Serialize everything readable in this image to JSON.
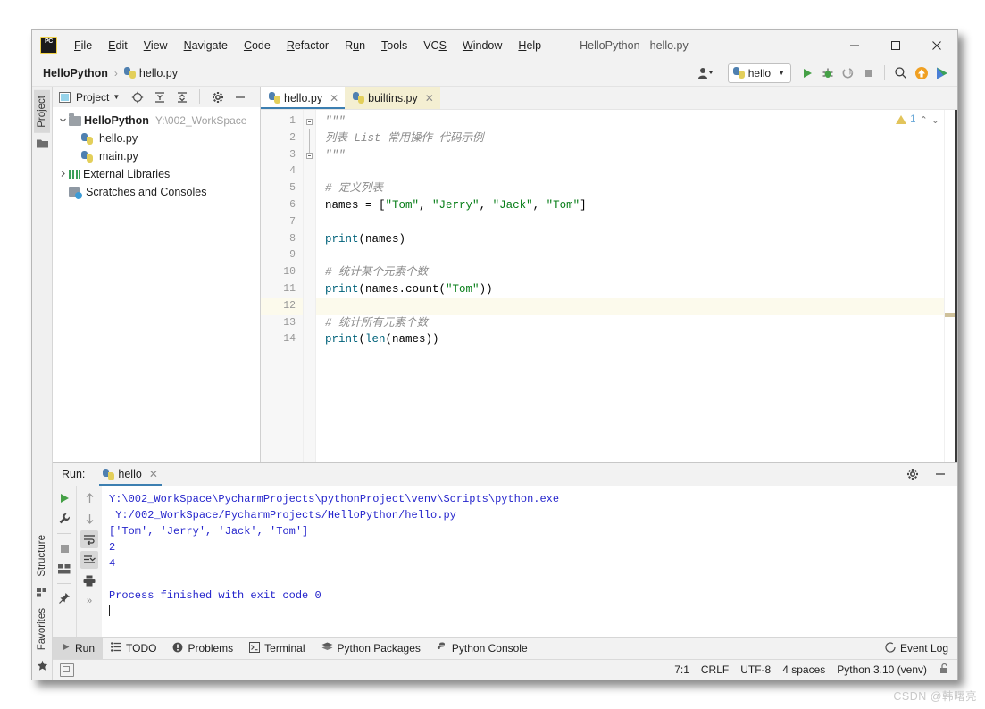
{
  "window": {
    "title": "HelloPython - hello.py",
    "logo_text": "PC",
    "minimize_label": "Minimize",
    "maximize_label": "Maximize",
    "close_label": "Close"
  },
  "menu": {
    "items": [
      {
        "mnemonic": "F",
        "rest": "ile"
      },
      {
        "mnemonic": "E",
        "rest": "dit"
      },
      {
        "mnemonic": "V",
        "rest": "iew"
      },
      {
        "mnemonic": "N",
        "rest": "avigate"
      },
      {
        "mnemonic": "C",
        "rest": "ode"
      },
      {
        "mnemonic": "R",
        "rest": "efactor"
      },
      {
        "mnemonic": "R",
        "rest": "un",
        "pre": "",
        "mid": "u"
      },
      {
        "mnemonic": "T",
        "rest": "ools"
      },
      {
        "mnemonic": "VC",
        "rest": "S"
      },
      {
        "mnemonic": "W",
        "rest": "indow"
      },
      {
        "mnemonic": "H",
        "rest": "elp"
      }
    ]
  },
  "navbar": {
    "breadcrumb_project": "HelloPython",
    "breadcrumb_sep": "›",
    "breadcrumb_file": "hello.py",
    "run_config": "hello",
    "icons": {
      "user": "user-avatar-icon",
      "run": "run-icon",
      "debug": "debug-icon",
      "coverage": "run-coverage-icon",
      "stop": "stop-icon",
      "search": "search-everywhere-icon",
      "update": "update-project-icon",
      "ide_help": "ide-features-trainer-icon"
    }
  },
  "left_strip": {
    "top": [
      {
        "label": "Project",
        "active": true
      }
    ],
    "bottom": [
      {
        "label": "Structure",
        "active": false
      },
      {
        "label": "Favorites",
        "active": false
      }
    ]
  },
  "project_panel": {
    "title": "Project",
    "toolbar_icons": [
      "locate-icon",
      "expand-all-icon",
      "collapse-all-icon",
      "settings-gear-icon",
      "hide-icon"
    ],
    "tree": [
      {
        "depth": 0,
        "arrow": "⌄",
        "icon": "folder-icon",
        "label": "HelloPython",
        "bold": true,
        "path": "Y:\\002_WorkSpace"
      },
      {
        "depth": 1,
        "arrow": "",
        "icon": "python-file-icon",
        "label": "hello.py",
        "bold": false,
        "path": ""
      },
      {
        "depth": 1,
        "arrow": "",
        "icon": "python-file-icon",
        "label": "main.py",
        "bold": false,
        "path": ""
      },
      {
        "depth": 0,
        "arrow": "›",
        "icon": "library-icon",
        "label": "External Libraries",
        "bold": false,
        "path": ""
      },
      {
        "depth": 0,
        "arrow": "",
        "icon": "scratches-icon",
        "label": "Scratches and Consoles",
        "bold": false,
        "path": ""
      }
    ]
  },
  "editor": {
    "tabs": [
      {
        "label": "hello.py",
        "active": true,
        "highlight": false
      },
      {
        "label": "builtins.py",
        "active": false,
        "highlight": true
      }
    ],
    "warning_count": "1",
    "lines": [
      {
        "n": 1,
        "tokens": [
          {
            "t": "\"\"\"",
            "c": "k-cmt"
          }
        ]
      },
      {
        "n": 2,
        "tokens": [
          {
            "t": "列表 List 常用操作 代码示例",
            "c": "k-cmt"
          }
        ]
      },
      {
        "n": 3,
        "tokens": [
          {
            "t": "\"\"\"",
            "c": "k-cmt"
          }
        ]
      },
      {
        "n": 4,
        "tokens": []
      },
      {
        "n": 5,
        "tokens": [
          {
            "t": "# 定义列表",
            "c": "k-cmt"
          }
        ]
      },
      {
        "n": 6,
        "tokens": [
          {
            "t": "names = [",
            "c": "k-def"
          },
          {
            "t": "\"Tom\"",
            "c": "k-str"
          },
          {
            "t": ", ",
            "c": "k-def"
          },
          {
            "t": "\"Jerry\"",
            "c": "k-str"
          },
          {
            "t": ", ",
            "c": "k-def"
          },
          {
            "t": "\"Jack\"",
            "c": "k-str"
          },
          {
            "t": ", ",
            "c": "k-def"
          },
          {
            "t": "\"Tom\"",
            "c": "k-str"
          },
          {
            "t": "]",
            "c": "k-def"
          }
        ]
      },
      {
        "n": 7,
        "tokens": []
      },
      {
        "n": 8,
        "tokens": [
          {
            "t": "print",
            "c": "k-fn"
          },
          {
            "t": "(names)",
            "c": "k-def"
          }
        ]
      },
      {
        "n": 9,
        "tokens": []
      },
      {
        "n": 10,
        "tokens": [
          {
            "t": "# 统计某个元素个数",
            "c": "k-cmt"
          }
        ]
      },
      {
        "n": 11,
        "tokens": [
          {
            "t": "print",
            "c": "k-fn"
          },
          {
            "t": "(names.count(",
            "c": "k-def"
          },
          {
            "t": "\"Tom\"",
            "c": "k-str"
          },
          {
            "t": "))",
            "c": "k-def"
          }
        ]
      },
      {
        "n": 12,
        "tokens": [],
        "current": true
      },
      {
        "n": 13,
        "tokens": [
          {
            "t": "# 统计所有元素个数",
            "c": "k-cmt"
          }
        ]
      },
      {
        "n": 14,
        "tokens": [
          {
            "t": "print",
            "c": "k-fn"
          },
          {
            "t": "(",
            "c": "k-def"
          },
          {
            "t": "len",
            "c": "k-fn"
          },
          {
            "t": "(names))",
            "c": "k-def"
          }
        ]
      }
    ]
  },
  "run_panel": {
    "label": "Run:",
    "tab_label": "hello",
    "gear_icon": "settings-gear-icon",
    "hide_icon": "hide-icon",
    "tool_icons_left": [
      "rerun-icon",
      "wrench-icon",
      "stop-icon",
      "layout-icon",
      "pin-icon"
    ],
    "tool_icons_right": [
      "up-arrow-icon",
      "down-arrow-icon",
      "soft-wrap-icon",
      "scroll-to-end-icon",
      "print-icon",
      "expand-more-icon"
    ],
    "console_lines": [
      "Y:\\002_WorkSpace\\PycharmProjects\\pythonProject\\venv\\Scripts\\python.exe",
      " Y:/002_WorkSpace/PycharmProjects/HelloPython/hello.py",
      "['Tom', 'Jerry', 'Jack', 'Tom']",
      "2",
      "4",
      "",
      "Process finished with exit code 0"
    ]
  },
  "bottom_tabs": [
    {
      "label": "Run",
      "icon": "run-icon",
      "active": true
    },
    {
      "label": "TODO",
      "icon": "todo-icon",
      "active": false
    },
    {
      "label": "Problems",
      "icon": "problems-icon",
      "active": false
    },
    {
      "label": "Terminal",
      "icon": "terminal-icon",
      "active": false
    },
    {
      "label": "Python Packages",
      "icon": "packages-icon",
      "active": false
    },
    {
      "label": "Python Console",
      "icon": "python-console-icon",
      "active": false
    }
  ],
  "event_log": {
    "label": "Event Log",
    "icon": "event-log-icon"
  },
  "statusbar": {
    "caret_position": "7:1",
    "line_separator": "CRLF",
    "encoding": "UTF-8",
    "indent": "4 spaces",
    "interpreter": "Python 3.10 (venv)",
    "lock_icon": "unlocked-icon"
  },
  "watermark": "CSDN @韩曙亮",
  "colors": {
    "accent_blue": "#3c7fb1",
    "string_green": "#067d17",
    "function_teal": "#00627a",
    "comment_gray": "#8c8c8c",
    "console_blue": "#2525cc",
    "tab_highlight": "#f4efd2",
    "warning_yellow": "#e2c45b"
  }
}
